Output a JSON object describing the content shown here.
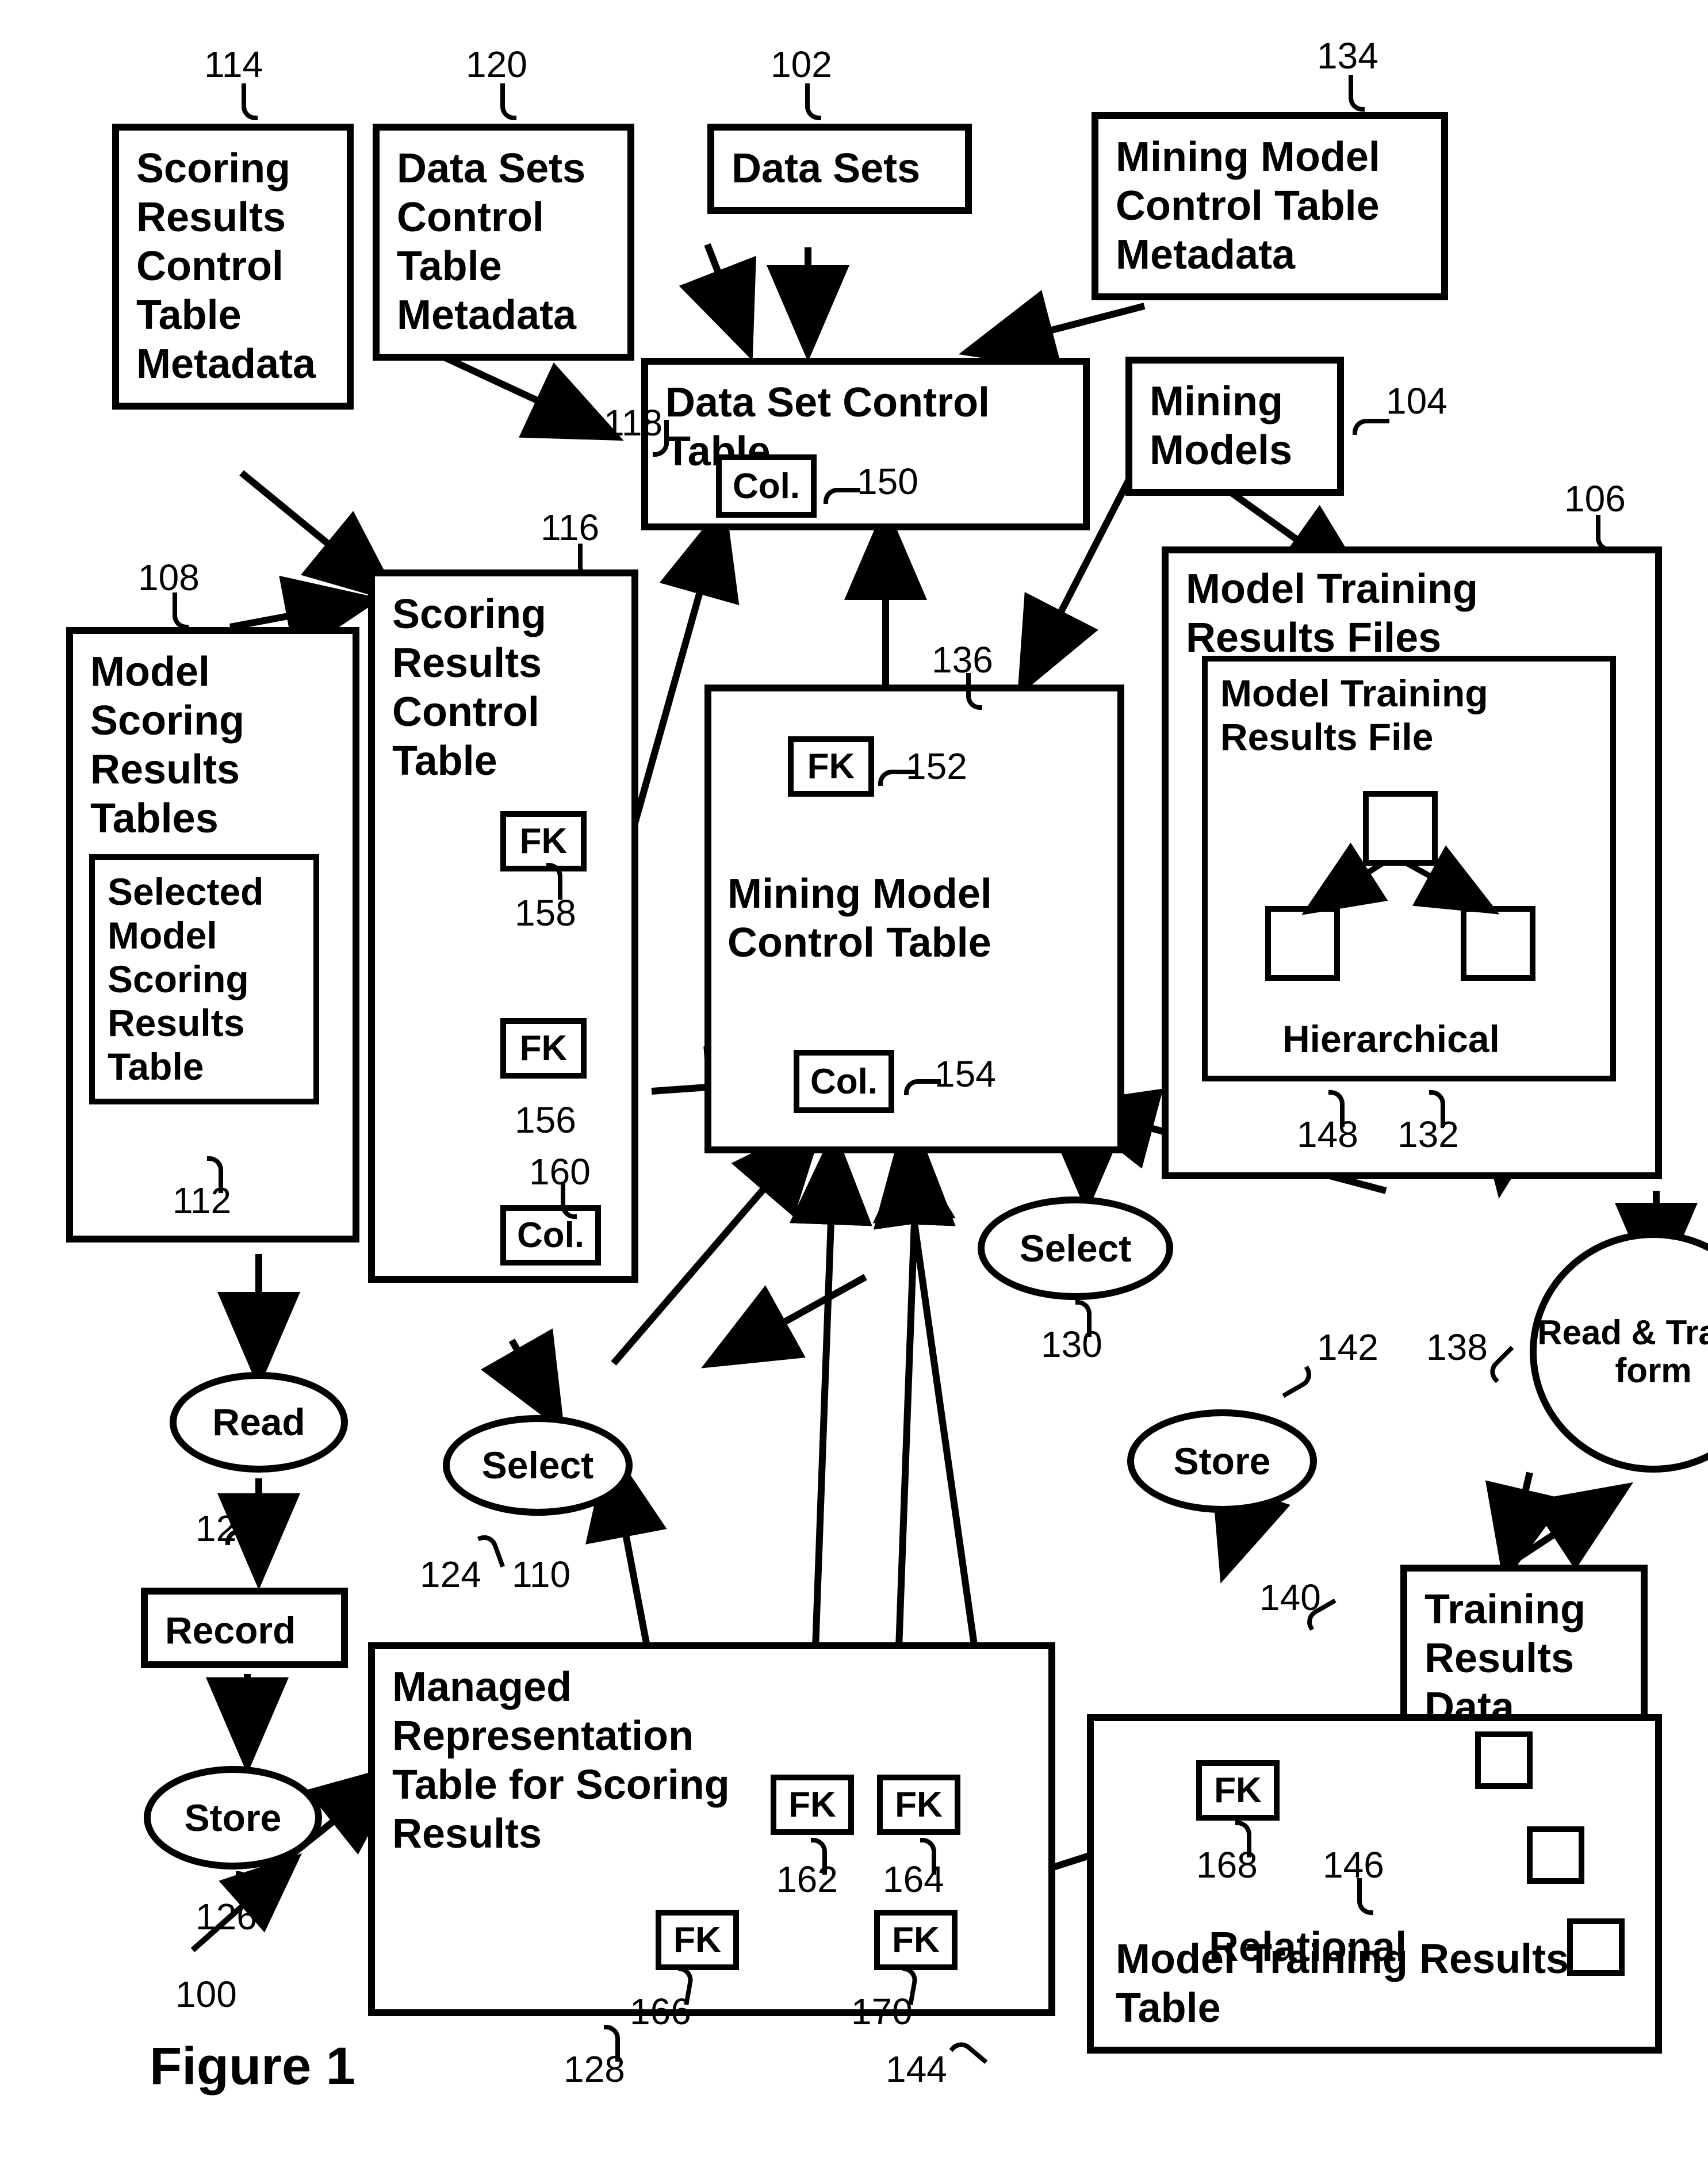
{
  "refs": {
    "r100": "100",
    "r102": "102",
    "r104": "104",
    "r106": "106",
    "r108": "108",
    "r110": "110",
    "r112": "112",
    "r114": "114",
    "r116": "116",
    "r118": "118",
    "r120": "120",
    "r122": "122",
    "r124": "124",
    "r126": "126",
    "r128": "128",
    "r130": "130",
    "r132": "132",
    "r134": "134",
    "r136": "136",
    "r138": "138",
    "r140": "140",
    "r142": "142",
    "r144": "144",
    "r146": "146",
    "r148": "148",
    "r150": "150",
    "r152": "152",
    "r154": "154",
    "r156": "156",
    "r158": "158",
    "r160": "160",
    "r162": "162",
    "r164": "164",
    "r166": "166",
    "r168": "168",
    "r170": "170"
  },
  "boxes": {
    "data_sets": "Data Sets",
    "mining_models": "Mining Models",
    "model_training_results_files": "Model Training Results Files",
    "model_training_results_file": "Model Training Results File",
    "hierarchical": "Hierarchical",
    "model_scoring_results_tables": "Model Scoring Results Tables",
    "selected_model_scoring_results_table": "Selected Model Scoring Results Table",
    "scoring_results_control_table_metadata": "Scoring Results Control Table Metadata",
    "scoring_results_control_table": "Scoring Results Control Table",
    "data_set_control_table": "Data Set Control Table",
    "data_sets_control_table_metadata": "Data Sets Control Table Metadata",
    "mining_model_control_table_metadata": "Mining Model Control Table Metadata",
    "mining_model_control_table": "Mining Model Control Table",
    "record": "Record",
    "managed_rep_table_scoring": "Managed Representation Table for Scoring Results",
    "training_results_data": "Training Results Data",
    "model_training_results_table": "Model Training Results Table",
    "relational": "Relational",
    "col": "Col.",
    "fk": "FK"
  },
  "ops": {
    "read": "Read",
    "select": "Select",
    "store": "Store",
    "read_transform": "Read & Trans- form"
  },
  "fig": "Figure 1"
}
